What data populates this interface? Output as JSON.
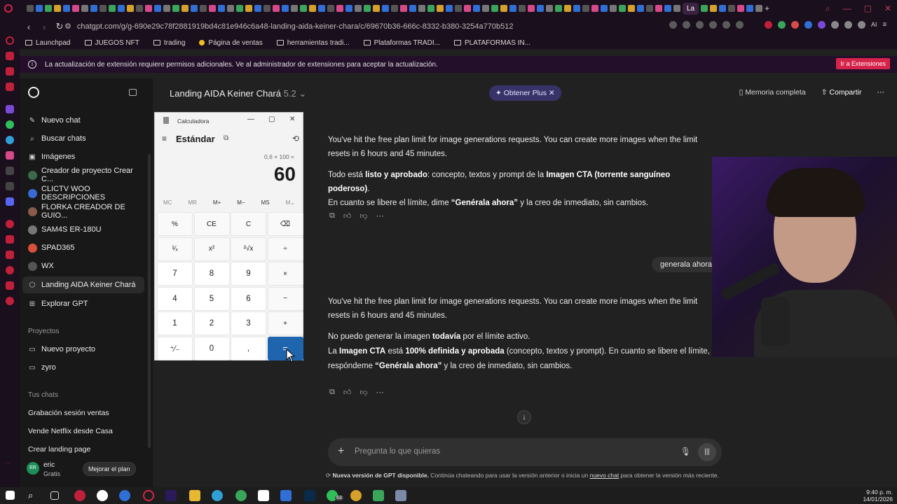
{
  "browser": {
    "active_tab_label": "La",
    "url": "chatgpt.com/g/g-690e29c78f2881919bd4c81e946c6a48-landing-aida-keiner-chara/c/69670b36-666c-8332-b380-3254a770b512",
    "bookmarks": [
      "Launchpad",
      "JUEGOS NFT",
      "trading",
      "Página de ventas",
      "herramientas tradi...",
      "Plataformas TRADI...",
      "PLATAFORMAS IN..."
    ],
    "infobar_text": "La actualización de extensión requiere permisos adicionales. Ve al administrador de extensiones para aceptar la actualización.",
    "infobar_button": "Ir a Extensiones",
    "ai_label": "AI"
  },
  "sidebar": {
    "items": [
      {
        "label": "Nuevo chat",
        "icon": "edit-icon"
      },
      {
        "label": "Buscar chats",
        "icon": "search-icon"
      },
      {
        "label": "Imágenes",
        "icon": "image-icon"
      },
      {
        "label": "Creador de proyecto Crear C...",
        "icon": "gpt-avatar"
      },
      {
        "label": "CLICTV WOO DESCRIPCIONES",
        "icon": "gpt-avatar"
      },
      {
        "label": "FLORKA CREADOR DE GUIO...",
        "icon": "gpt-avatar"
      },
      {
        "label": "SAM4S ER-180U",
        "icon": "gpt-avatar"
      },
      {
        "label": "SPAD365",
        "icon": "gpt-avatar"
      },
      {
        "label": "WX",
        "icon": "gpt-avatar"
      },
      {
        "label": "Landing AIDA Keiner Chará",
        "icon": "gpt-cube-icon"
      },
      {
        "label": "Explorar GPT",
        "icon": "grid-icon"
      }
    ],
    "projects_header": "Proyectos",
    "projects": [
      {
        "label": "Nuevo proyecto",
        "icon": "folder-plus-icon"
      },
      {
        "label": "zyro",
        "icon": "folder-icon"
      }
    ],
    "chats_header": "Tus chats",
    "chats": [
      "Grabación sesión ventas",
      "Vende Netflix desde Casa",
      "Crear landing page"
    ],
    "user": {
      "initials": "ER",
      "name": "eric",
      "plan": "Gratis",
      "upgrade_label": "Mejorar el plan"
    }
  },
  "header": {
    "title": "Landing AIDA Keiner Chará",
    "version": "5.2",
    "plus_label": "Obtener Plus",
    "memory_label": "Memoria completa",
    "share_label": "Compartir"
  },
  "messages": {
    "m1_p1": "You've hit the free plan limit for image generations requests. You can create more images when the limit resets in 6 hours and 45 minutes.",
    "m1_p2_a": "Todo está ",
    "m1_p2_b": "listo y aprobado",
    "m1_p2_c": ": concepto, textos y prompt de la ",
    "m1_p2_d": "Imagen CTA (torrente sanguíneo poderoso)",
    "m1_p2_e": ".",
    "m1_p3_a": "En cuanto se libere el límite, dime ",
    "m1_p3_b": "“Genérala ahora”",
    "m1_p3_c": " y la creo de inmediato, sin cambios.",
    "user_msg": "generala ahora",
    "m2_p1": "You've hit the free plan limit for image generations requests. You can create more images when the limit resets in 6 hours and 45 minutes.",
    "m2_p2_a": "No puedo generar la imagen ",
    "m2_p2_b": "todavía",
    "m2_p2_c": " por el límite activo.",
    "m2_p3_a": "La ",
    "m2_p3_b": "Imagen CTA",
    "m2_p3_c": " está ",
    "m2_p3_d": "100% definida y aprobada",
    "m2_p3_e": " (concepto, textos y prompt). En cuanto se libere el límite,",
    "m2_p4_a": "respóndeme ",
    "m2_p4_b": "“Genérala ahora”",
    "m2_p4_c": " y la creo de inmediato, sin cambios."
  },
  "composer": {
    "placeholder": "Pregunta lo que quieras"
  },
  "footer": {
    "bold": "Nueva versión de GPT disponible.",
    "text": " Continúa chateando para usar la versión anterior o inicia un ",
    "link": "nuevo chat",
    "text2": " para obtener la versión más reciente."
  },
  "calculator": {
    "window_title": "Calculadora",
    "mode": "Estándar",
    "expression": "0,6 × 100 =",
    "display": "60",
    "memory": [
      "MC",
      "MR",
      "M+",
      "M−",
      "MS",
      "M⌄"
    ],
    "keys": [
      "%",
      "CE",
      "C",
      "⌫",
      "¹⁄ₓ",
      "x²",
      "²√x",
      "÷",
      "7",
      "8",
      "9",
      "×",
      "4",
      "5",
      "6",
      "−",
      "1",
      "2",
      "3",
      "+",
      "⁺⁄₋",
      "0",
      ",",
      "="
    ]
  },
  "taskbar": {
    "time": "9:40 p. m.",
    "date": "14/01/2026",
    "whatsapp_badge": "63"
  },
  "colors": {
    "accent_blue": "#1f65ad",
    "opera_red": "#d6234a",
    "plus_pill": "#373369"
  }
}
